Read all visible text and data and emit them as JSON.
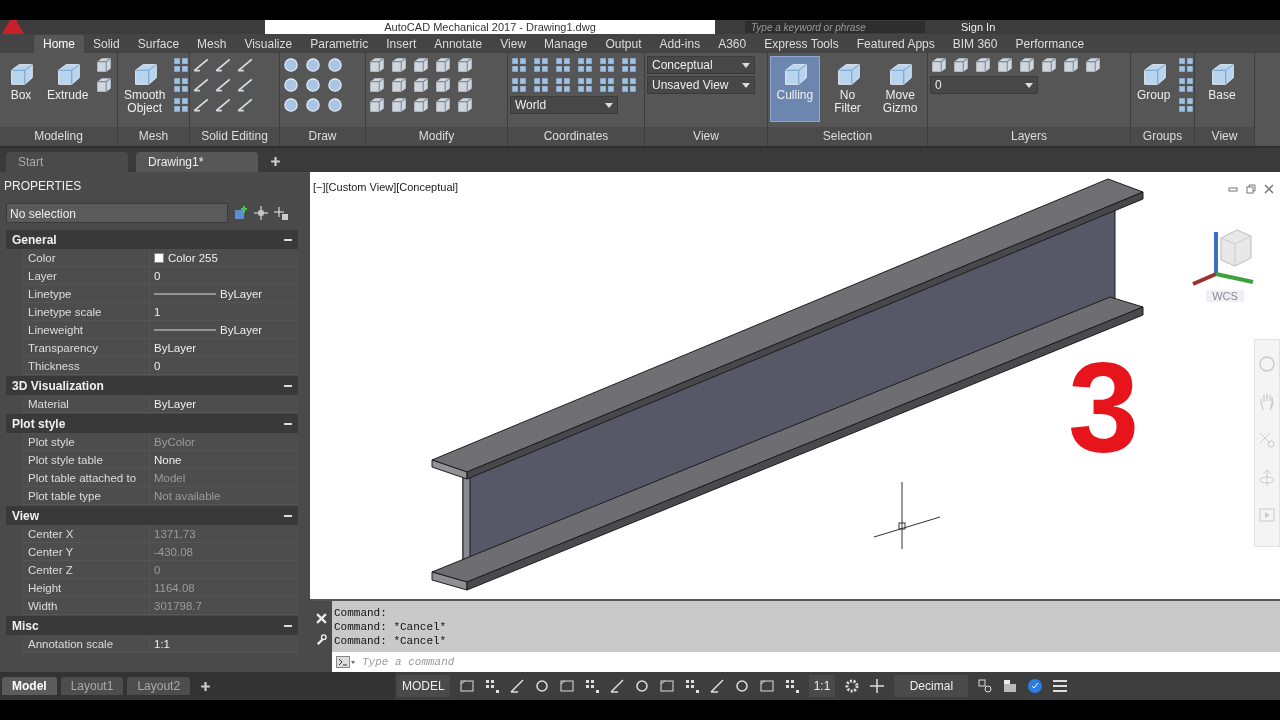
{
  "title_bar": {
    "title": "AutoCAD Mechanical 2017 - Drawing1.dwg",
    "search": {
      "placeholder": "Type a keyword or phrase"
    },
    "sign_in": "Sign In"
  },
  "ribbon_tabs": [
    {
      "label": "Home",
      "selected": true
    },
    {
      "label": "Solid",
      "selected": false
    },
    {
      "label": "Surface",
      "selected": false
    },
    {
      "label": "Mesh",
      "selected": false
    },
    {
      "label": "Visualize",
      "selected": false
    },
    {
      "label": "Parametric",
      "selected": false
    },
    {
      "label": "Insert",
      "selected": false
    },
    {
      "label": "Annotate",
      "selected": false
    },
    {
      "label": "View",
      "selected": false
    },
    {
      "label": "Manage",
      "selected": false
    },
    {
      "label": "Output",
      "selected": false
    },
    {
      "label": "Add-ins",
      "selected": false
    },
    {
      "label": "A360",
      "selected": false
    },
    {
      "label": "Express Tools",
      "selected": false
    },
    {
      "label": "Featured Apps",
      "selected": false
    },
    {
      "label": "BIM 360",
      "selected": false
    },
    {
      "label": "Performance",
      "selected": false
    }
  ],
  "ribbon_panels": [
    {
      "title": "Modeling",
      "tools": [
        {
          "kind": "large",
          "label": "Box",
          "selected": false
        },
        {
          "kind": "large",
          "label": "Extrude",
          "selected": false
        }
      ]
    },
    {
      "title": "Mesh",
      "tools": [
        {
          "kind": "large",
          "label": "Smooth Object",
          "selected": false
        }
      ]
    },
    {
      "title": "Solid Editing"
    },
    {
      "title": "Draw"
    },
    {
      "title": "Modify"
    },
    {
      "title": "Coordinates",
      "tools": [
        {
          "kind": "dropdown",
          "value": "World"
        }
      ]
    },
    {
      "title": "View",
      "tools": [
        {
          "kind": "dropdown",
          "value": "Conceptual"
        },
        {
          "kind": "dropdown",
          "value": "Unsaved View"
        }
      ]
    },
    {
      "title": "Selection",
      "tools": [
        {
          "kind": "large",
          "label": "Culling",
          "selected": true
        },
        {
          "kind": "large",
          "label": "No Filter",
          "selected": false
        },
        {
          "kind": "large",
          "label": "Move Gizmo",
          "selected": false
        }
      ]
    },
    {
      "title": "Layers",
      "tools": [
        {
          "kind": "dropdown",
          "value": "0"
        }
      ]
    },
    {
      "title": "Groups",
      "tools": [
        {
          "kind": "large",
          "label": "Group",
          "selected": false
        }
      ]
    },
    {
      "title": "View",
      "tools": [
        {
          "kind": "large",
          "label": "Base",
          "selected": false
        }
      ]
    }
  ],
  "document_tabs": [
    {
      "label": "Start",
      "selected": false
    },
    {
      "label": "Drawing1*",
      "selected": true
    }
  ],
  "properties": {
    "title": "PROPERTIES",
    "selection": "No selection",
    "sections": [
      {
        "title": "General",
        "expanded": true,
        "rows": [
          {
            "label": "Color",
            "value": "Color 255",
            "kind": "color",
            "disabled": false
          },
          {
            "label": "Layer",
            "value": "0",
            "kind": "text",
            "disabled": false
          },
          {
            "label": "Linetype",
            "value": "ByLayer",
            "kind": "line",
            "disabled": false
          },
          {
            "label": "Linetype scale",
            "value": "1",
            "kind": "text",
            "disabled": false
          },
          {
            "label": "Lineweight",
            "value": "ByLayer",
            "kind": "line",
            "disabled": false
          },
          {
            "label": "Transparency",
            "value": "ByLayer",
            "kind": "text",
            "disabled": false
          },
          {
            "label": "Thickness",
            "value": "0",
            "kind": "text",
            "disabled": false
          }
        ]
      },
      {
        "title": "3D Visualization",
        "expanded": true,
        "rows": [
          {
            "label": "Material",
            "value": "ByLayer",
            "kind": "text",
            "disabled": false
          }
        ]
      },
      {
        "title": "Plot style",
        "expanded": true,
        "rows": [
          {
            "label": "Plot style",
            "value": "ByColor",
            "kind": "text",
            "disabled": true
          },
          {
            "label": "Plot style table",
            "value": "None",
            "kind": "text",
            "disabled": false
          },
          {
            "label": "Plot table attached to",
            "value": "Model",
            "kind": "text",
            "disabled": true
          },
          {
            "label": "Plot table type",
            "value": "Not available",
            "kind": "text",
            "disabled": true
          }
        ]
      },
      {
        "title": "View",
        "expanded": true,
        "rows": [
          {
            "label": "Center X",
            "value": "1371.73",
            "kind": "text",
            "disabled": true
          },
          {
            "label": "Center Y",
            "value": "-430.08",
            "kind": "text",
            "disabled": true
          },
          {
            "label": "Center Z",
            "value": "0",
            "kind": "text",
            "disabled": true
          },
          {
            "label": "Height",
            "value": "1164.08",
            "kind": "text",
            "disabled": true
          },
          {
            "label": "Width",
            "value": "301798.7",
            "kind": "text",
            "disabled": true
          }
        ]
      },
      {
        "title": "Misc",
        "expanded": true,
        "rows": [
          {
            "label": "Annotation scale",
            "value": "1:1",
            "kind": "text",
            "disabled": false
          }
        ]
      }
    ]
  },
  "viewport": {
    "label": "[−][Custom View][Conceptual]",
    "overlay_number": "3",
    "view_cube": {
      "label": "WCS"
    }
  },
  "command_line": {
    "history": [
      "Command:",
      "Command: *Cancel*",
      "Command: *Cancel*"
    ],
    "placeholder": "Type a command"
  },
  "layout_tabs": [
    {
      "label": "Model",
      "selected": true
    },
    {
      "label": "Layout1",
      "selected": false
    },
    {
      "label": "Layout2",
      "selected": false
    }
  ],
  "status_bar": {
    "model": "MODEL",
    "scale": "1:1",
    "units": "Decimal"
  }
}
